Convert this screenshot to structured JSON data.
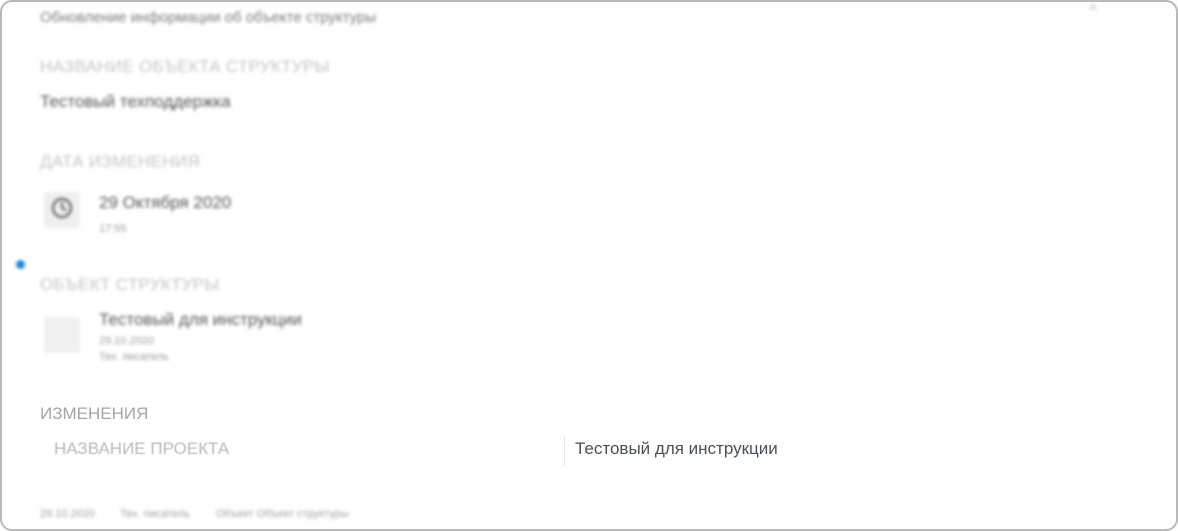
{
  "window": {
    "title": "Обновление информации об объекте структуры",
    "collapse_glyph": "^"
  },
  "sections": {
    "object_name": {
      "label": "НАЗВАНИЕ ОБЪЕКТА СТРУКТУРЫ",
      "value": "Тестовый техподдержка"
    },
    "change_date": {
      "label": "ДАТА ИЗМЕНЕНИЯ",
      "icon": "clock-icon",
      "date": "29 Октября 2020",
      "time": "17:55"
    },
    "structure_object": {
      "label": "ОБЪЕКТ СТРУКТУРЫ",
      "title": "Тестовый для инструкции",
      "date": "29.10.2020",
      "author": "Тех. писатель"
    },
    "changes": {
      "label": "ИЗМЕНЕНИЯ",
      "rows": [
        {
          "field": "НАЗВАНИЕ ПРОЕКТА",
          "value": "Тестовый для инструкции"
        }
      ]
    }
  },
  "footer": {
    "date": "29.10.2020",
    "author": "Тех. писатель",
    "object": "Объект Объект структуры"
  },
  "colors": {
    "indicator_dot": "#1e86d6",
    "border": "#b9b9b9"
  }
}
